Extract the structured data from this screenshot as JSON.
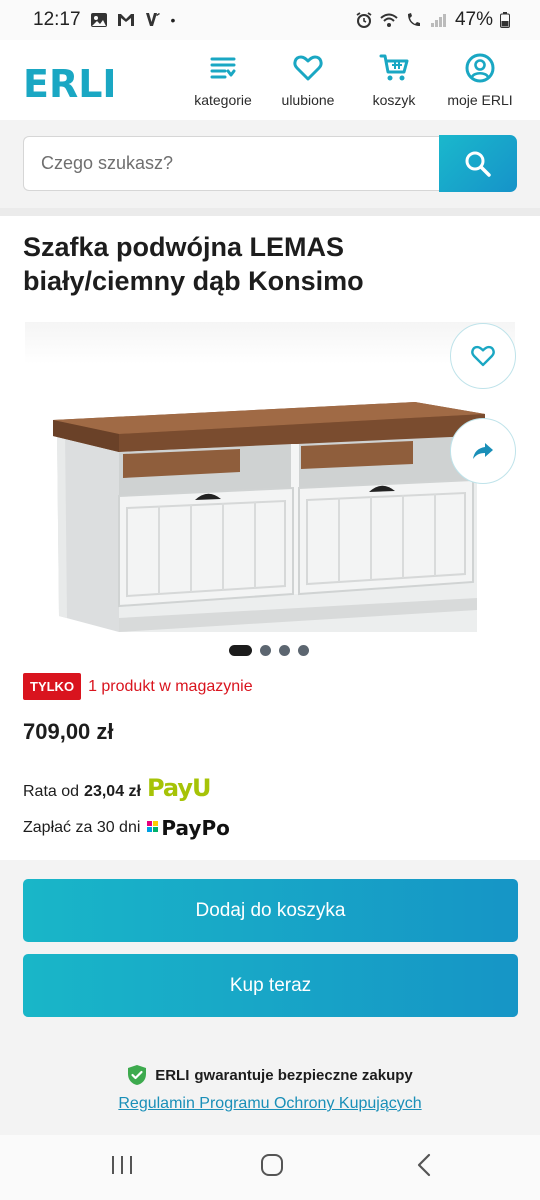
{
  "status_bar": {
    "time": "12:17",
    "dot": "•",
    "battery": "47%",
    "icons": [
      "gallery-icon",
      "gmail-icon",
      "vinted-icon",
      "alarm-icon",
      "wifi-icon",
      "wifi-calling-icon",
      "signal-icon",
      "battery-icon"
    ]
  },
  "header": {
    "logo": "ERLI",
    "nav": [
      {
        "label": "kategorie",
        "icon": "category-list-icon"
      },
      {
        "label": "ulubione",
        "icon": "heart-icon"
      },
      {
        "label": "koszyk",
        "icon": "cart-icon"
      },
      {
        "label": "moje ERLI",
        "icon": "user-icon"
      }
    ]
  },
  "search": {
    "placeholder": "Czego szukasz?",
    "button_icon": "search-icon"
  },
  "product": {
    "title": "Szafka podwójna LEMAS biały/ciemny dąb Konsimo",
    "gallery": {
      "slides": 4,
      "active": 1,
      "image": "white tv cabinet with dark oak top and two drawers"
    },
    "badge": "TYLKO",
    "stock": "1 produkt w magazynie",
    "price": "709,00 zł",
    "rata_label": "Rata od",
    "rata_value": "23,04 zł",
    "payu_logo": "PayU",
    "paypo_label": "Zapłać za 30 dni",
    "paypo_logo": "PayPo"
  },
  "actions": {
    "add_to_cart": "Dodaj do koszyka",
    "buy_now": "Kup teraz"
  },
  "guarantee": {
    "logo": "ERLI",
    "text": "gwarantuje bezpieczne zakupy",
    "link": "Regulamin Programu Ochrony Kupujących"
  },
  "colors": {
    "brand": "#1aa7c3",
    "cta": "#17a8c7",
    "stock_red": "#d9141e",
    "payu_green": "#a6c307"
  }
}
